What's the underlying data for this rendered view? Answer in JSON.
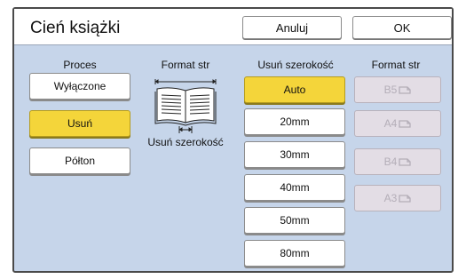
{
  "header": {
    "title": "Cień książki",
    "cancel_label": "Anuluj",
    "ok_label": "OK"
  },
  "columns": {
    "process": "Proces",
    "format_left": "Format str",
    "erase_width": "Usuń szerokość",
    "format_right": "Format str"
  },
  "process_options": [
    "Wyłączone",
    "Usuń",
    "Półton"
  ],
  "process_selected": "Usuń",
  "book_label": "Usuń szerokość",
  "width_options": [
    "Auto",
    "20mm",
    "30mm",
    "40mm",
    "50mm",
    "80mm"
  ],
  "width_selected": "Auto",
  "paper_sizes": [
    "B5",
    "A4",
    "B4",
    "A3"
  ],
  "colors": {
    "accent": "#f4d53a",
    "panel": "#c6d5ea",
    "disabled": "#e3dde5"
  }
}
